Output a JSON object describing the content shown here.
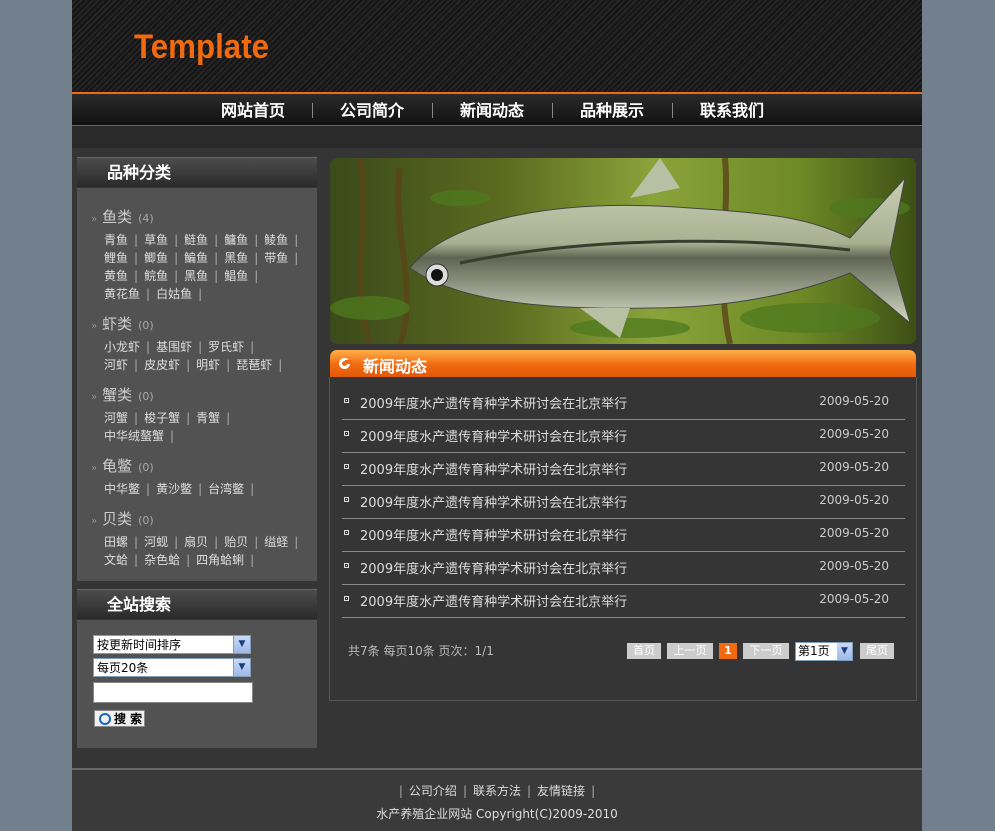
{
  "header": {
    "logo": "Template"
  },
  "nav": [
    "网站首页",
    "公司简介",
    "新闻动态",
    "品种展示",
    "联系我们"
  ],
  "sidebar": {
    "category_title": "品种分类",
    "categories": [
      {
        "name": "鱼类",
        "count": "(4)",
        "rows": [
          [
            "青鱼",
            "草鱼",
            "鲢鱼",
            "鳙鱼",
            "鲮鱼"
          ],
          [
            "鲤鱼",
            "鲫鱼",
            "鳊鱼",
            "黑鱼",
            "带鱼"
          ],
          [
            "黄鱼",
            "鲩鱼",
            "黑鱼",
            "鲳鱼"
          ],
          [
            "黄花鱼",
            "白姑鱼"
          ]
        ]
      },
      {
        "name": "虾类",
        "count": "(0)",
        "rows": [
          [
            "小龙虾",
            "基围虾",
            "罗氏虾"
          ],
          [
            "河虾",
            "皮皮虾",
            "明虾",
            "琵琶虾"
          ]
        ]
      },
      {
        "name": "蟹类",
        "count": "(0)",
        "rows": [
          [
            "河蟹",
            "梭子蟹",
            "青蟹"
          ],
          [
            "中华绒螯蟹"
          ]
        ]
      },
      {
        "name": "龟鳖",
        "count": "(0)",
        "rows": [
          [
            "中华鳖",
            "黄沙鳖",
            "台湾鳖"
          ]
        ]
      },
      {
        "name": "贝类",
        "count": "(0)",
        "rows": [
          [
            "田螺",
            "河蚬",
            "扇贝",
            "贻贝",
            "缢蛏"
          ],
          [
            "文蛤",
            "杂色蛤",
            "四角蛤蜊"
          ]
        ]
      }
    ],
    "search_title": "全站搜索",
    "sort_select": "按更新时间排序",
    "per_page_select": "每页20条",
    "search_input": "",
    "search_button": "搜 索"
  },
  "news": {
    "title": "新闻动态",
    "items": [
      {
        "title": "2009年度水产遗传育种学术研讨会在北京举行",
        "date": "2009-05-20"
      },
      {
        "title": "2009年度水产遗传育种学术研讨会在北京举行",
        "date": "2009-05-20"
      },
      {
        "title": "2009年度水产遗传育种学术研讨会在北京举行",
        "date": "2009-05-20"
      },
      {
        "title": "2009年度水产遗传育种学术研讨会在北京举行",
        "date": "2009-05-20"
      },
      {
        "title": "2009年度水产遗传育种学术研讨会在北京举行",
        "date": "2009-05-20"
      },
      {
        "title": "2009年度水产遗传育种学术研讨会在北京举行",
        "date": "2009-05-20"
      },
      {
        "title": "2009年度水产遗传育种学术研讨会在北京举行",
        "date": "2009-05-20"
      }
    ],
    "pagination": {
      "info": "共7条  每页10条  页次：1/1",
      "first": "首页",
      "prev": "上一页",
      "current": "1",
      "next": "下一页",
      "page_select": "第1页",
      "last": "尾页"
    }
  },
  "footer": {
    "links": [
      "公司介绍",
      "联系方法",
      "友情链接"
    ],
    "copyright": "水产养殖企业网站  Copyright(C)2009-2010"
  },
  "colors": {
    "accent": "#f26a10",
    "page_bg": "#72808e",
    "content_bg": "#353535"
  }
}
